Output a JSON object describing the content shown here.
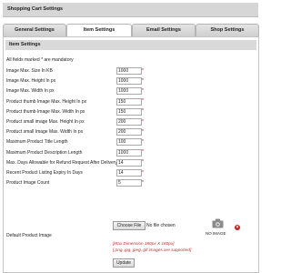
{
  "header": {
    "title": "Shopping Cart Settings"
  },
  "tabs": [
    {
      "label": "General Settings"
    },
    {
      "label": "Item Settings"
    },
    {
      "label": "Email Settings"
    },
    {
      "label": "Shop Settings"
    }
  ],
  "active_tab": "Item Settings",
  "section": {
    "title": "Item Settings"
  },
  "note": "All fields marked * are mandatory",
  "fields": [
    {
      "label": "Image Max. Size In KB",
      "value": "1000",
      "required": "*"
    },
    {
      "label": "Image Max. Height In px",
      "value": "1000",
      "required": "*"
    },
    {
      "label": "Image Max. Width In px",
      "value": "1000",
      "required": "*"
    },
    {
      "label": "Product thumb Image Max. Height In px",
      "value": "150",
      "required": "*"
    },
    {
      "label": "Product thumb Image Max. Width In px",
      "value": "150",
      "required": "*"
    },
    {
      "label": "Product small image Max. Height In px",
      "value": "200",
      "required": "*"
    },
    {
      "label": "Product small Image Max. Width In px",
      "value": "200",
      "required": "*"
    },
    {
      "label": "Maximum Product Title Length",
      "value": "100",
      "required": "*"
    },
    {
      "label": "Maximum Product Description Length",
      "value": "1000",
      "required": "*"
    },
    {
      "label": "Max. Days Allowable for Refund Request After Delivery",
      "value": "14",
      "required": "*"
    },
    {
      "label": "Recent Product Listing Expiry In Days",
      "value": "14",
      "required": "*"
    },
    {
      "label": "Product Image Count",
      "value": "5",
      "required": "*"
    }
  ],
  "default_image": {
    "label": "Default Product Image",
    "choose_button": "Choose File",
    "file_status": "No file chosen",
    "no_image_label": "NO IMAGE",
    "remove_symbol": "×",
    "hint_dimension": "[Max Dimension 180px X 180px]",
    "hint_types": "[.png,.jpg,.jpeg,.gif images are supported]"
  },
  "update_button": "Update",
  "colors": {
    "required": "#cc0000",
    "hint": "#c03030",
    "remove": "#c82020"
  }
}
